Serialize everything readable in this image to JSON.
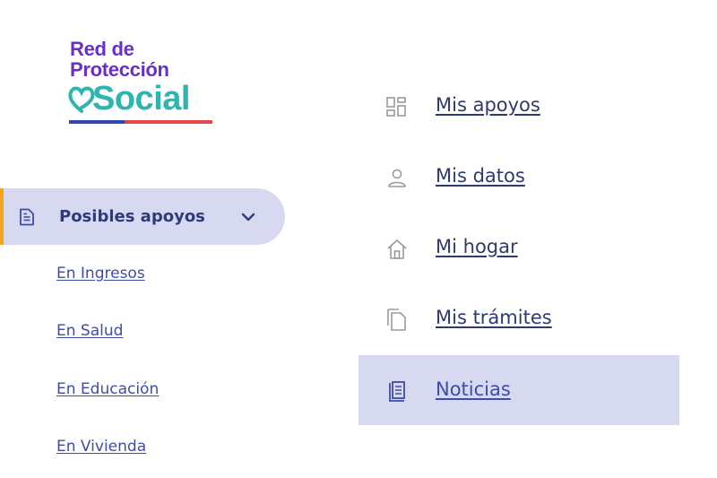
{
  "logo": {
    "line1": "Red de",
    "line2": "Protección",
    "line3": "Social"
  },
  "left_nav": {
    "active": {
      "label": "Posibles apoyos",
      "icon": "document-icon",
      "expanded": true
    },
    "sub_items": [
      {
        "label": "En Ingresos"
      },
      {
        "label": "En Salud"
      },
      {
        "label": "En Educación"
      },
      {
        "label": "En Vivienda"
      }
    ]
  },
  "right_nav": {
    "items": [
      {
        "label": "Mis apoyos",
        "icon": "grid-icon"
      },
      {
        "label": "Mis datos",
        "icon": "user-icon"
      },
      {
        "label": "Mi hogar",
        "icon": "home-icon"
      },
      {
        "label": "Mis trámites",
        "icon": "files-icon"
      },
      {
        "label": "Noticias",
        "icon": "newspaper-icon",
        "active": true
      }
    ]
  },
  "colors": {
    "brand_purple": "#6a2fc9",
    "brand_teal": "#2fb5b0",
    "active_bg": "#d6d9f0",
    "accent_orange": "#f5a21d",
    "link_blue": "#3e4da7"
  }
}
